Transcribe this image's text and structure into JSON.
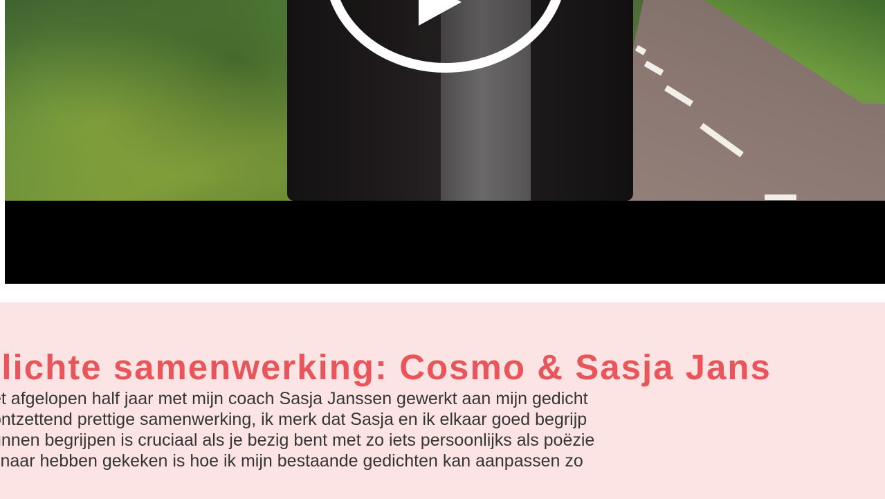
{
  "video": {
    "play_icon": "play-icon"
  },
  "article": {
    "title": "elichte samenwerking: Cosmo & Sasja Jans",
    "lines": [
      "et afgelopen half jaar met mijn coach Sasja Janssen gewerkt aan mijn gedicht",
      "ontzettend prettige samenwerking, ik merk dat Sasja en ik elkaar goed begrijp",
      "unnen begrijpen is cruciaal als je bezig bent met zo iets persoonlijks als poëzie",
      "l naar hebben gekeken is hoe ik mijn bestaande gedichten kan aanpassen zo"
    ]
  },
  "colors": {
    "title": "#e8555a",
    "article_bg": "#fde4e4",
    "body_text": "#353535"
  }
}
